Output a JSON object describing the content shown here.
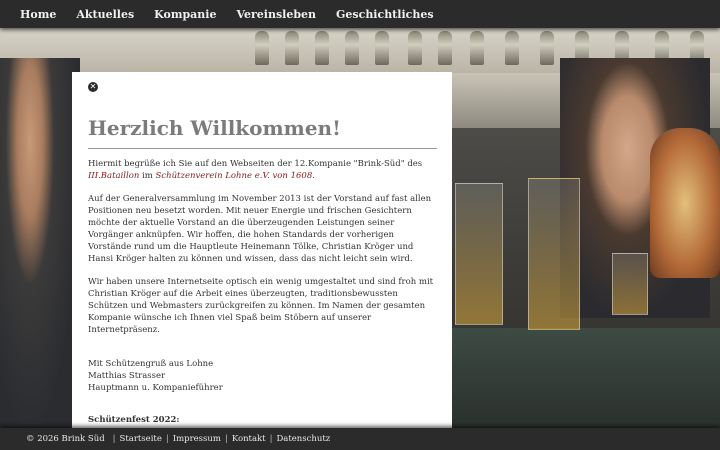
{
  "nav": {
    "items": [
      "Home",
      "Aktuelles",
      "Kompanie",
      "Vereinsleben",
      "Geschichtliches"
    ]
  },
  "panel": {
    "close_icon": "close-icon",
    "title": "Herzlich Willkommen!",
    "intro_prefix": "Hiermit begrüße ich Sie auf den Webseiten der 12.Kompanie \"Brink-Süd\" des ",
    "intro_link1": "III.Bataillon",
    "intro_mid": " im ",
    "intro_link2": "Schützenverein Lohne e.V. von 1608",
    "intro_suffix": ".",
    "para2": "Auf der Generalversammlung im November 2013 ist der Vorstand auf fast allen Positionen neu besetzt worden. Mit neuer Energie und frischen Gesichtern möchte der aktuelle Vorstand an die überzeugenden Leistungen seiner Vorgänger anknüpfen. Wir hoffen, die hohen Standards der vorherigen Vorstände rund um die Hauptleute Heinemann Tölke, Christian Kröger und Hansi Kröger halten zu können und wissen, dass das nicht leicht sein wird.",
    "para3": "Wir haben unsere Internetseite optisch ein wenig umgestaltet und sind froh mit Christian Kröger auf die Arbeit eines überzeugten, traditionsbewussten Schützen und Webmasters zurückgreifen zu können. Im Namen der gesamten Kompanie wünsche ich Ihnen viel Spaß beim Stöbern auf unserer Internetpräsenz.",
    "sig_greeting": "Mit Schützengruß aus Lohne",
    "sig_name": "Matthias Strasser",
    "sig_role": "Hauptmann u. Kompanieführer",
    "section_heading": "Schützenfest 2022:"
  },
  "footer": {
    "copyright": "© 2026 Brink Süd",
    "links": [
      "Startseite",
      "Impressum",
      "Kontakt",
      "Datenschutz"
    ]
  },
  "colors": {
    "bar": "#2b2b2b",
    "accent_red": "#8a1a1a",
    "title_gray": "#7b7b7b"
  }
}
